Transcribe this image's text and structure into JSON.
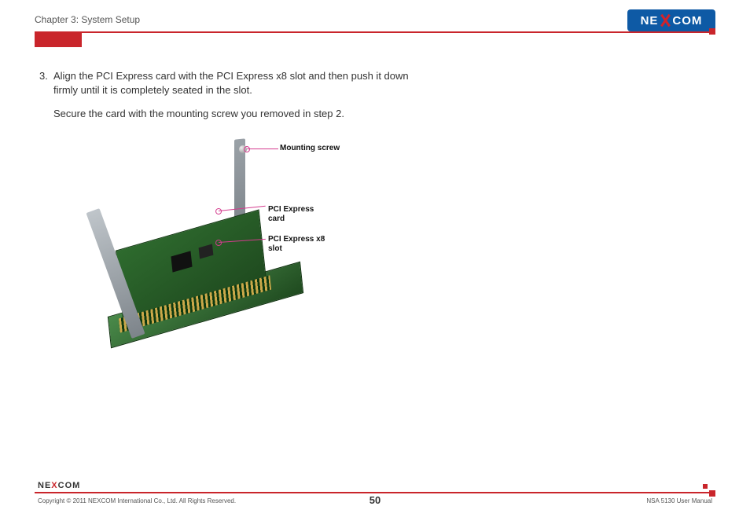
{
  "header": {
    "chapter": "Chapter 3: System Setup",
    "logo_left": "NE",
    "logo_right": "COM"
  },
  "step": {
    "number": "3.",
    "text1": "Align the PCI Express card with the PCI Express x8 slot and then push it down firmly until it is completely seated in the slot.",
    "text2": "Secure the card with the mounting screw you removed in step 2."
  },
  "callouts": {
    "screw": "Mounting screw",
    "card": "PCI Express card",
    "slot": "PCI Express x8 slot"
  },
  "footer": {
    "logo_left": "NE",
    "logo_x": "X",
    "logo_right": "COM",
    "copyright": "Copyright © 2011 NEXCOM International Co., Ltd. All Rights Reserved.",
    "page": "50",
    "manual": "NSA 5130 User Manual"
  }
}
